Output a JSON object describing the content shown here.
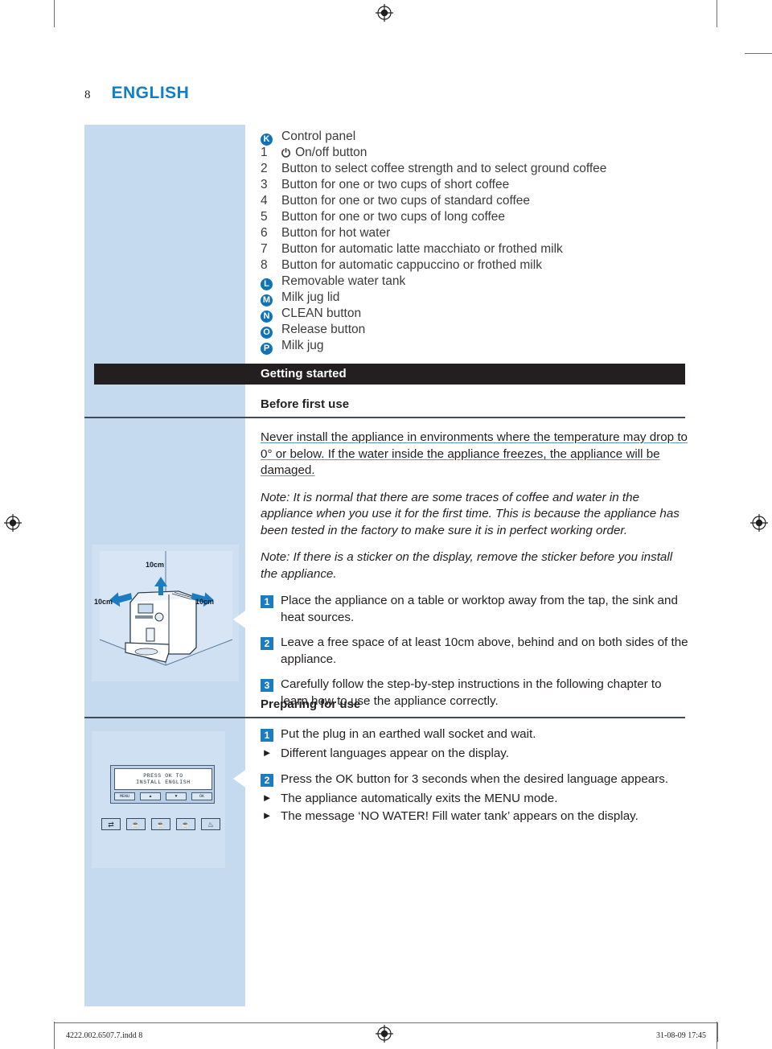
{
  "page": {
    "number": "8",
    "language": "ENGLISH"
  },
  "parts_list": [
    {
      "marker": "K",
      "marker_type": "badge",
      "label": "Control panel"
    },
    {
      "marker": "1",
      "marker_type": "num",
      "icon": "power-icon",
      "label": "On/off button"
    },
    {
      "marker": "2",
      "marker_type": "num",
      "label": "Button to select coffee strength and to select ground coffee"
    },
    {
      "marker": "3",
      "marker_type": "num",
      "label": "Button for one or two cups of short coffee"
    },
    {
      "marker": "4",
      "marker_type": "num",
      "label": "Button for one or two cups of standard coffee"
    },
    {
      "marker": "5",
      "marker_type": "num",
      "label": "Button for one or two cups of long coffee"
    },
    {
      "marker": "6",
      "marker_type": "num",
      "label": "Button for hot water"
    },
    {
      "marker": "7",
      "marker_type": "num",
      "label": "Button for automatic latte macchiato or frothed milk"
    },
    {
      "marker": "8",
      "marker_type": "num",
      "label": "Button for automatic cappuccino or frothed milk"
    },
    {
      "marker": "L",
      "marker_type": "badge",
      "label": "Removable water tank"
    },
    {
      "marker": "M",
      "marker_type": "badge",
      "label": "Milk jug lid"
    },
    {
      "marker": "N",
      "marker_type": "badge",
      "label": "CLEAN button"
    },
    {
      "marker": "O",
      "marker_type": "badge",
      "label": "Release button"
    },
    {
      "marker": "P",
      "marker_type": "badge",
      "label": "Milk jug"
    }
  ],
  "section_bar": {
    "title": "Getting started"
  },
  "before_first_use": {
    "heading": "Before first use",
    "warning": "Never install the appliance in environments where the temperature may drop to 0° or below. If the water inside the appliance freezes, the appliance will be damaged.",
    "note_1": "Note: It is normal that there are some traces of coffee and water in the appliance when you use it for the first time. This is because the appliance has been tested in the factory to make sure it is in perfect working order.",
    "note_2": "Note: If there is a sticker on the display, remove the sticker before you install the appliance.",
    "steps": [
      {
        "num": "1",
        "text": "Place the appliance on a table or worktop away from the tap, the sink and heat sources."
      },
      {
        "num": "2",
        "text": "Leave a free space of at least 10cm above, behind and on both sides of the appliance."
      },
      {
        "num": "3",
        "text": "Carefully follow the step-by-step instructions in the following chapter to learn how to use the appliance correctly."
      }
    ]
  },
  "preparing_for_use": {
    "heading": "Preparing for use",
    "items": [
      {
        "type": "step",
        "num": "1",
        "text": "Put the plug in an earthed wall socket and wait."
      },
      {
        "type": "bullet",
        "text": "Different languages appear on the display."
      },
      {
        "type": "step",
        "num": "2",
        "text": "Press the OK button for 3 seconds when the desired language appears."
      },
      {
        "type": "bullet",
        "text": "The appliance automatically exits the MENU mode."
      },
      {
        "type": "bullet",
        "text": "The message ‘NO WATER! Fill water tank’ appears on the display."
      }
    ]
  },
  "illustration_machine": {
    "labels": [
      "10cm",
      "10cm",
      "10cm"
    ]
  },
  "illustration_display": {
    "screen_line_1": "PRESS OK TO",
    "screen_line_2": "INSTALL ENGLISH",
    "buttons": [
      "MENU",
      "▲",
      "▼",
      "OK"
    ],
    "icon_keys": [
      "⇄",
      "☕",
      "☕",
      "☕",
      "♨"
    ]
  },
  "footer": {
    "left": "4222.002.6507.7.indd   8",
    "right": "31-08-09   17:45"
  },
  "colors": {
    "brand_blue": "#0f80c6",
    "panel_blue": "#c5d9ef",
    "badge_blue": "#1073b8",
    "step_blue": "#1c7cc0",
    "bar_dark": "#231f20"
  }
}
